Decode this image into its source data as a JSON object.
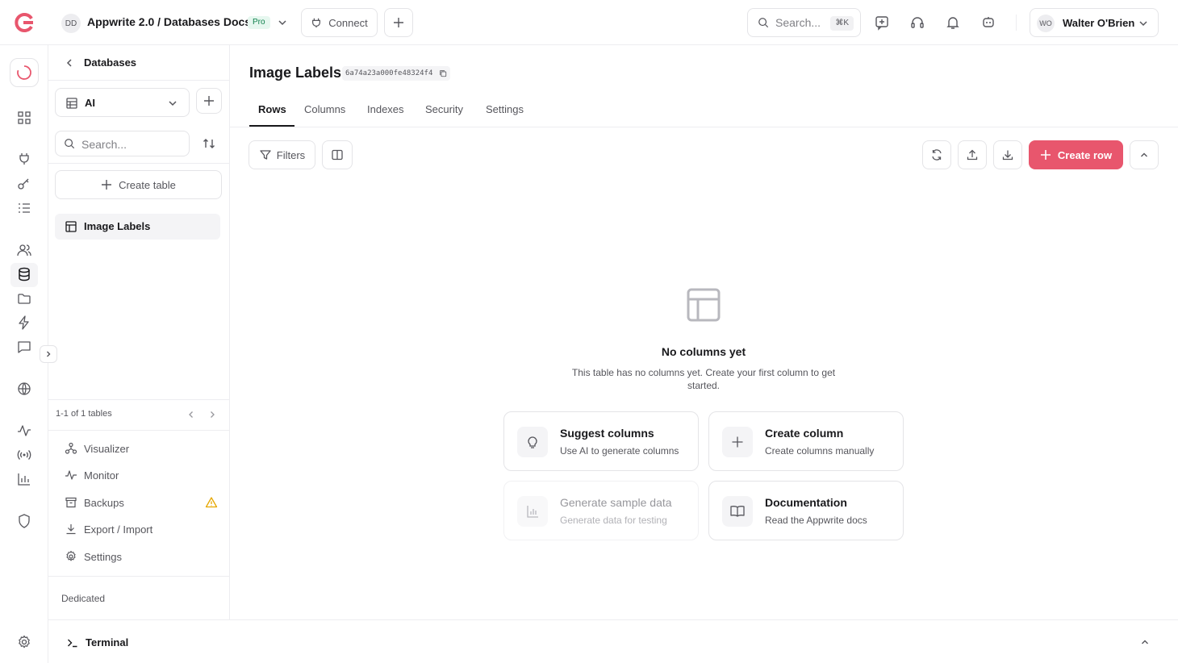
{
  "topbar": {
    "project_initials": "DD",
    "project_name": "Appwrite 2.0 / Databases Docs",
    "plan_badge": "Pro",
    "connect_label": "Connect",
    "search_placeholder": "Search...",
    "search_shortcut": "⌘K",
    "user_initials": "WO",
    "user_name": "Walter O'Brien"
  },
  "sidebar": {
    "title": "Databases",
    "database_selected": "AI",
    "search_placeholder": "Search...",
    "create_table_label": "Create table",
    "tables": [
      {
        "label": "Image Labels"
      }
    ],
    "pager_text": "1-1 of 1 tables",
    "links": [
      {
        "label": "Visualizer"
      },
      {
        "label": "Monitor"
      },
      {
        "label": "Backups"
      },
      {
        "label": "Export / Import"
      },
      {
        "label": "Settings"
      }
    ],
    "footer_label": "Dedicated"
  },
  "main": {
    "title": "Image Labels",
    "table_id": "6a74a23a000fe48324f4",
    "tabs": [
      {
        "label": "Rows",
        "active": true
      },
      {
        "label": "Columns"
      },
      {
        "label": "Indexes"
      },
      {
        "label": "Security"
      },
      {
        "label": "Settings"
      }
    ],
    "filters_label": "Filters",
    "create_row_label": "Create row",
    "empty": {
      "title": "No columns yet",
      "description": "This table has no columns yet. Create your first column to get started."
    },
    "cards": [
      {
        "title": "Suggest columns",
        "description": "Use AI to generate columns",
        "icon": "lightbulb-icon"
      },
      {
        "title": "Create column",
        "description": "Create columns manually",
        "icon": "plus-icon"
      },
      {
        "title": "Generate sample data",
        "description": "Generate data for testing",
        "icon": "chart-bars-icon",
        "disabled": true
      },
      {
        "title": "Documentation",
        "description": "Read the Appwrite docs",
        "icon": "book-icon"
      }
    ]
  },
  "terminal": {
    "label": "Terminal"
  },
  "colors": {
    "accent": "#e8566d",
    "border": "#e4e4e7",
    "text": "#19191c",
    "muted": "#56565c",
    "warning": "#e6a700"
  }
}
